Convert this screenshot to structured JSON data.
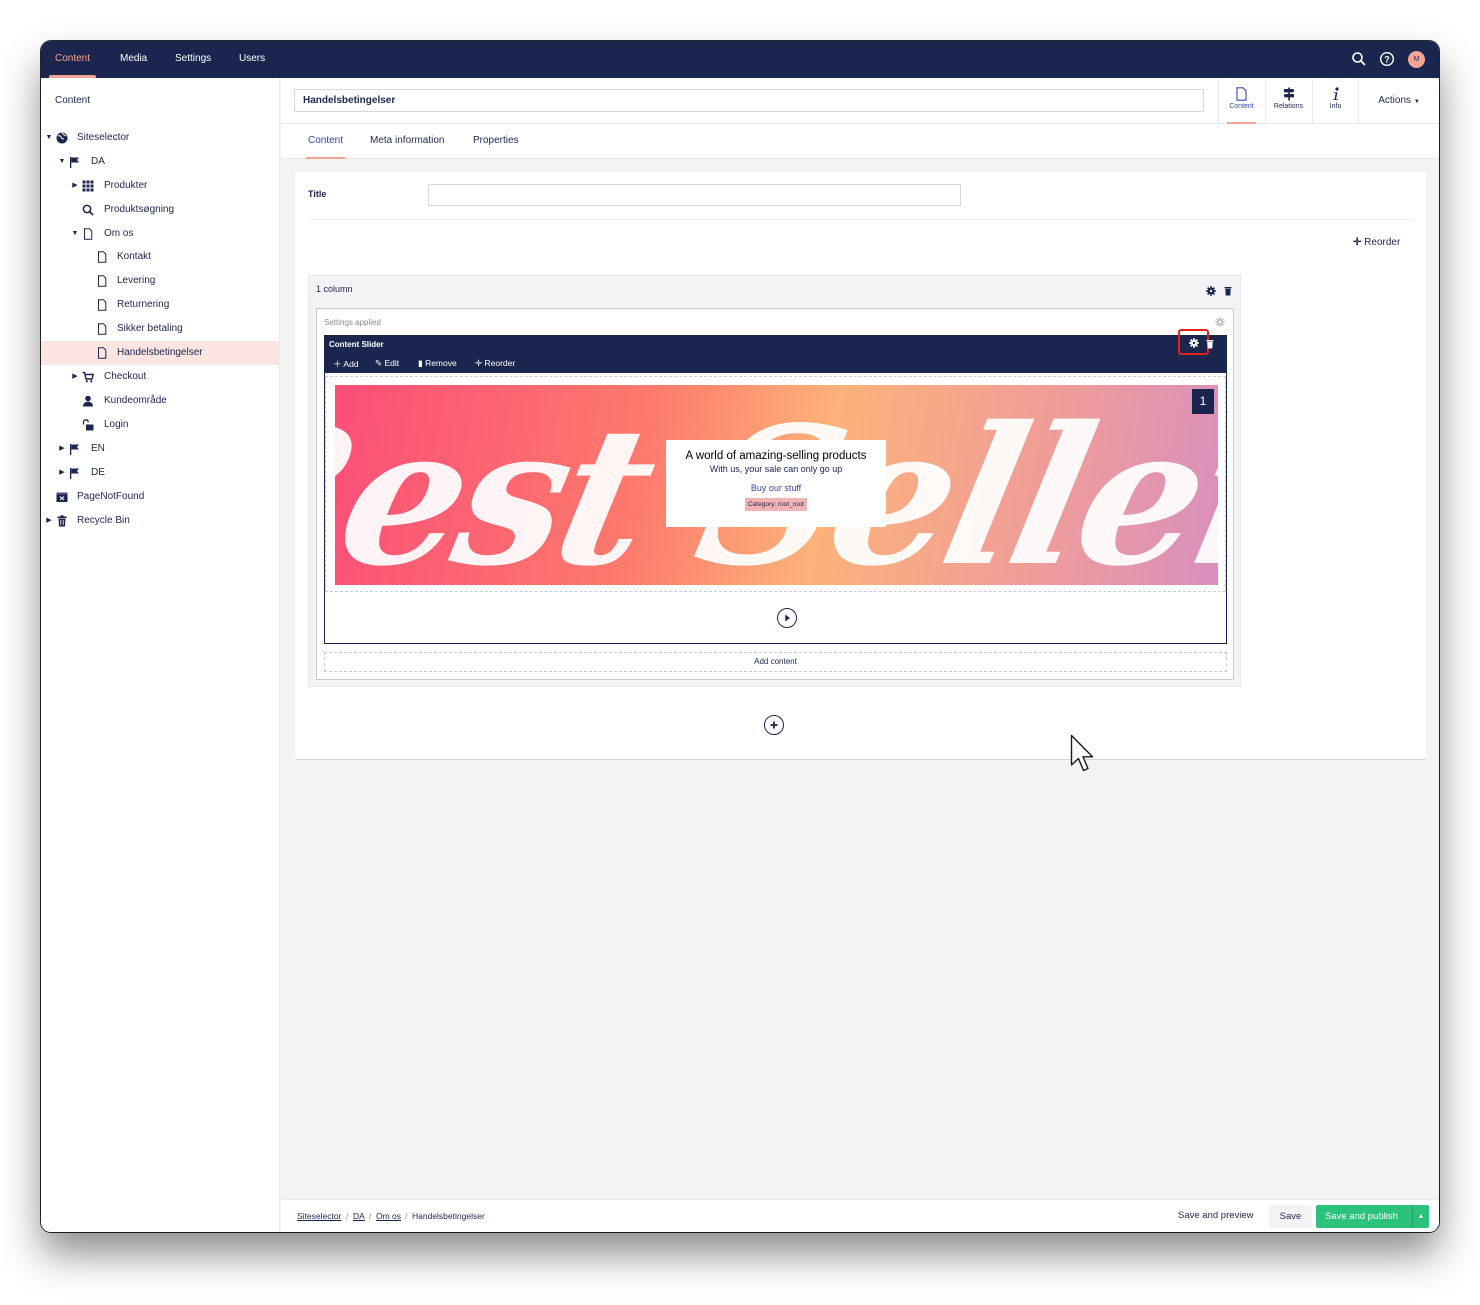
{
  "topnav": {
    "sections": [
      "Content",
      "Media",
      "Settings",
      "Users"
    ],
    "active": "Content",
    "avatar_initial": "M",
    "accent_color": "#f5a395",
    "bar_color": "#1b264f"
  },
  "sidebar": {
    "title": "Content",
    "tree": [
      {
        "label": "Siteselector",
        "icon": "globe-icon",
        "caret": "down"
      },
      {
        "label": "DA",
        "icon": "flag-icon",
        "caret": "down"
      },
      {
        "label": "Produkter",
        "icon": "grid-icon",
        "caret": "right"
      },
      {
        "label": "Produktsøgning",
        "icon": "search-icon",
        "caret": ""
      },
      {
        "label": "Om os",
        "icon": "document-icon",
        "caret": "down"
      },
      {
        "label": "Kontakt",
        "icon": "document-icon",
        "caret": ""
      },
      {
        "label": "Levering",
        "icon": "document-icon",
        "caret": ""
      },
      {
        "label": "Returnering",
        "icon": "document-icon",
        "caret": ""
      },
      {
        "label": "Sikker betaling",
        "icon": "document-icon",
        "caret": ""
      },
      {
        "label": "Handelsbetingelser",
        "icon": "document-icon",
        "caret": "",
        "selected": true
      },
      {
        "label": "Checkout",
        "icon": "cart-icon",
        "caret": "right"
      },
      {
        "label": "Kundeområde",
        "icon": "user-icon",
        "caret": ""
      },
      {
        "label": "Login",
        "icon": "lock-icon",
        "caret": ""
      },
      {
        "label": "EN",
        "icon": "flag-icon",
        "caret": "right"
      },
      {
        "label": "DE",
        "icon": "flag-icon",
        "caret": "right"
      },
      {
        "label": "PageNotFound",
        "icon": "page-not-found-icon",
        "caret": ""
      },
      {
        "label": "Recycle Bin",
        "icon": "trash-icon",
        "caret": "right"
      }
    ]
  },
  "editor": {
    "name_value": "Handelsbetingelser",
    "apps": [
      {
        "label": "Content",
        "icon": "document-icon",
        "active": true
      },
      {
        "label": "Relations",
        "icon": "signpost-icon",
        "active": false
      },
      {
        "label": "Info",
        "icon": "info-icon",
        "active": false
      }
    ],
    "actions_label": "Actions",
    "tabs": [
      "Content",
      "Meta information",
      "Properties"
    ],
    "active_tab": "Content"
  },
  "form": {
    "title_label": "Title",
    "title_value": "",
    "reorder_label": "Reorder"
  },
  "grid": {
    "row_label": "1 column",
    "settings_applied": "Settings applied",
    "slider": {
      "title": "Content Slider",
      "tools": [
        "Add",
        "Edit",
        "Remove",
        "Reorder"
      ],
      "slide_number": "1",
      "banner_script_text": "Best Sellers",
      "caption_title": "A world of amazing-selling products",
      "caption_subtitle": "With us, your sale can only go up",
      "caption_link": "Buy our stuff",
      "caption_tag": "Category: root_root"
    },
    "add_content_label": "Add content"
  },
  "footer": {
    "breadcrumbs": [
      "Siteselector",
      "DA",
      "Om os"
    ],
    "current": "Handelsbetingelser",
    "save_preview_label": "Save and preview",
    "save_label": "Save",
    "publish_label": "Save and publish",
    "publish_color": "#2bc37c"
  }
}
